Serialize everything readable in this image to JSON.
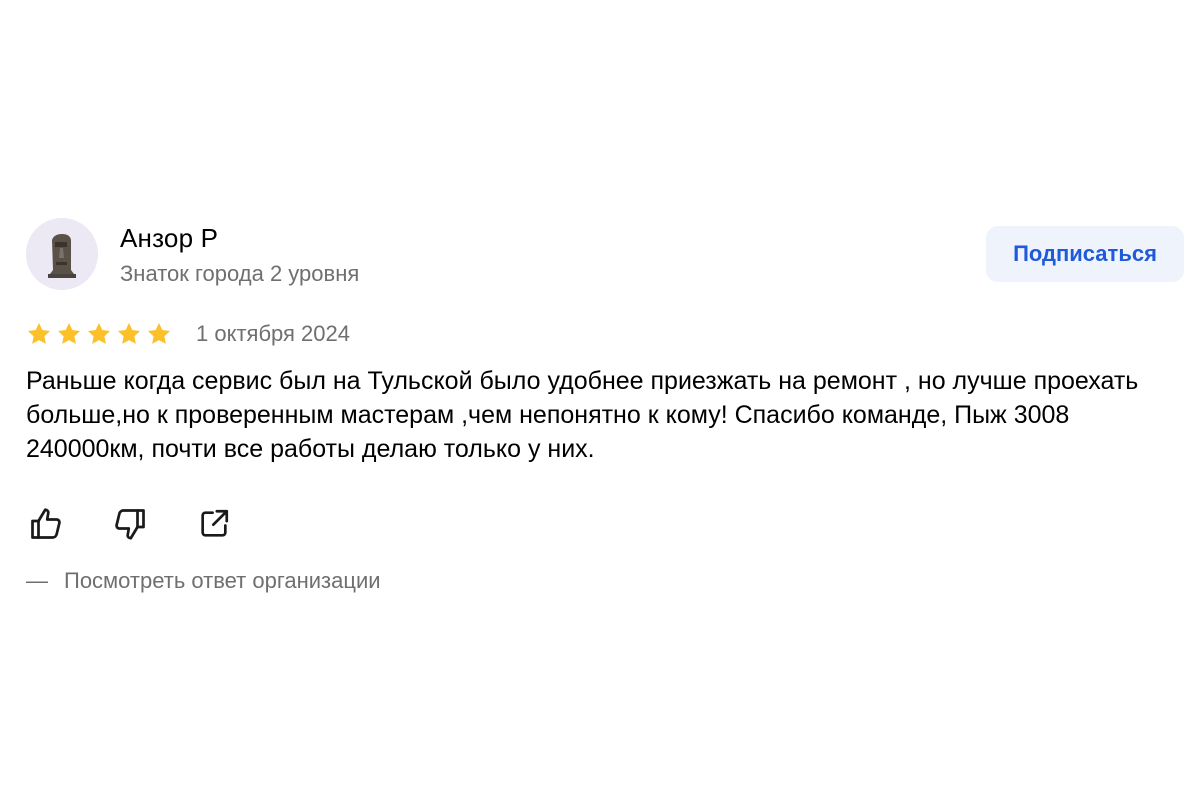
{
  "author": {
    "name": "Анзор Р",
    "level": "Знаток города 2 уровня",
    "avatar_icon": "moai-statue-icon"
  },
  "subscribe": {
    "label": "Подписаться",
    "color": "#1f5bd8",
    "background": "#eef3fc"
  },
  "rating": {
    "stars": 5,
    "max": 5,
    "color": "#fcc02b"
  },
  "date": "1 октября 2024",
  "review_text": "Раньше когда сервис был на Тульской было удобнее приезжать на ремонт , но лучше проехать больше,но к проверенным мастерам ,чем непонятно к кому! Спасибо команде, Пыж 3008 240000км, почти все работы делаю только у них.",
  "actions": [
    {
      "icon": "thumbs-up-icon"
    },
    {
      "icon": "thumbs-down-icon"
    },
    {
      "icon": "share-icon"
    }
  ],
  "reply_link": {
    "dash": "—",
    "label": "Посмотреть ответ организации"
  }
}
